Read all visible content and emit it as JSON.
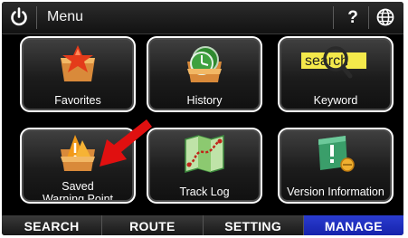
{
  "header": {
    "power_icon": "power-icon",
    "title": "Menu",
    "help_label": "?",
    "globe_icon": "globe-icon"
  },
  "menu": {
    "items": [
      {
        "label": "Favorites",
        "icon": "favorites-icon"
      },
      {
        "label": "History",
        "icon": "history-icon"
      },
      {
        "label": "Keyword",
        "icon": "keyword-icon",
        "icon_text": "search"
      },
      {
        "label_line1": "Saved",
        "label_line2": "Warning Point",
        "icon": "warning-point-icon"
      },
      {
        "label": "Track Log",
        "icon": "track-log-icon"
      },
      {
        "label": "Version Information",
        "icon": "version-info-icon"
      }
    ]
  },
  "bottom_nav": {
    "tabs": [
      {
        "label": "SEARCH",
        "active": false
      },
      {
        "label": "ROUTE",
        "active": false
      },
      {
        "label": "SETTING",
        "active": false
      },
      {
        "label": "MANAGE",
        "active": true
      }
    ]
  },
  "annotation": {
    "arrow_color": "#e01010"
  },
  "colors": {
    "active_tab": "#1c2fc4",
    "background": "#000000"
  }
}
